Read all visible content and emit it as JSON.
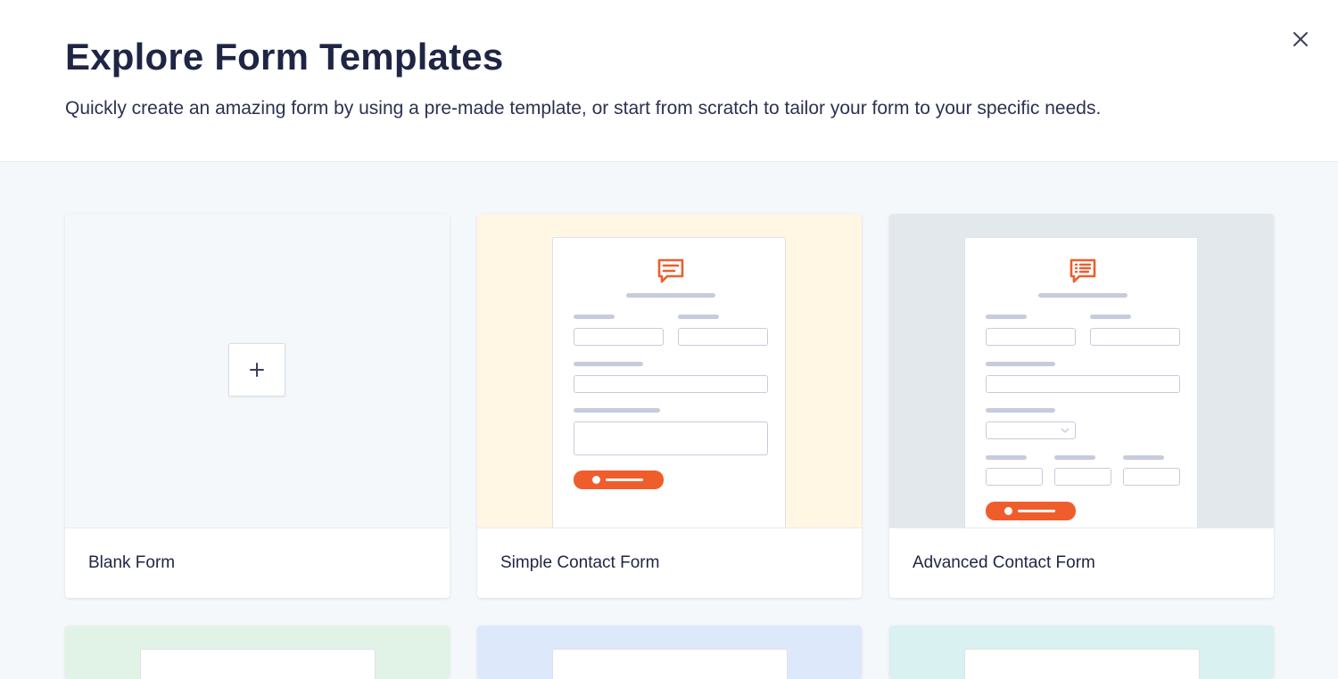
{
  "header": {
    "title": "Explore Form Templates",
    "subtitle": "Quickly create an amazing form by using a pre-made template, or start from scratch to tailor your form to your specific needs."
  },
  "colors": {
    "accent": "#f05d2c",
    "simple_bg": "#fff6e4",
    "advanced_bg": "#e3e8ec",
    "blank_bg": "#f5f8fb",
    "row2_green": "#e1f3e6",
    "row2_blue": "#dde9fb",
    "row2_teal": "#d9f1f0"
  },
  "templates": [
    {
      "label": "Blank Form",
      "icon": "plus-icon"
    },
    {
      "label": "Simple Contact Form",
      "icon": "chat-message-icon"
    },
    {
      "label": "Advanced Contact Form",
      "icon": "chat-list-icon"
    }
  ],
  "icons": {
    "close": "close-icon"
  }
}
